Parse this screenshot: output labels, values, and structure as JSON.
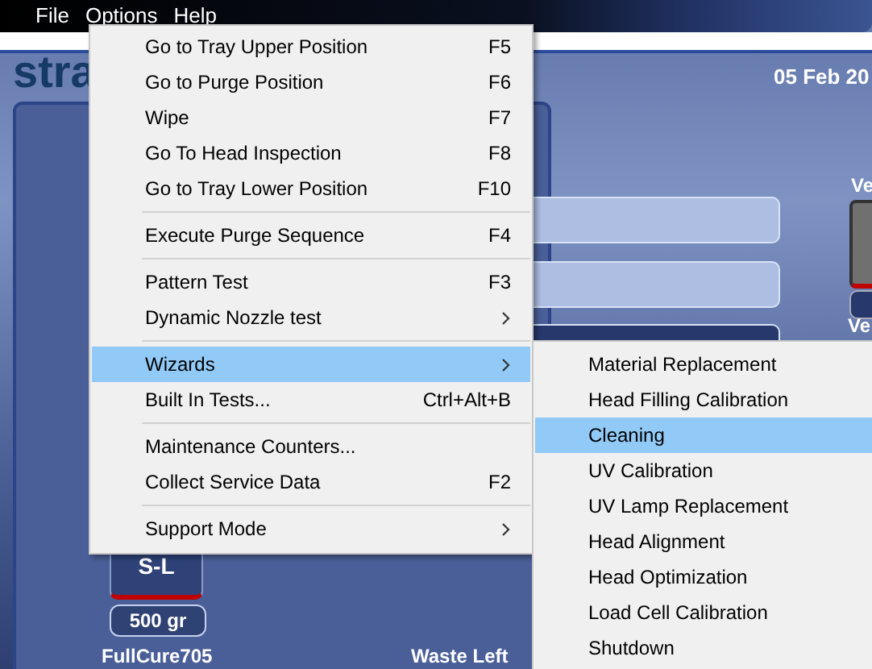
{
  "menu_bar": [
    {
      "label": "File"
    },
    {
      "label": "Options"
    },
    {
      "label": "Help"
    }
  ],
  "app": {
    "logo": "stra",
    "date": "05 Feb 20",
    "side_labels": [
      "Ve",
      "Ve"
    ],
    "cartridge": {
      "label": "S-L",
      "weight": "500 gr",
      "material": "FullCure705"
    },
    "waste_label": "Waste Left"
  },
  "options_menu": [
    {
      "kind": "item",
      "label": "Go to Tray Upper Position",
      "shortcut": "F5",
      "has_submenu": false,
      "selected": false
    },
    {
      "kind": "item",
      "label": "Go to Purge Position",
      "shortcut": "F6",
      "has_submenu": false,
      "selected": false
    },
    {
      "kind": "item",
      "label": "Wipe",
      "shortcut": "F7",
      "has_submenu": false,
      "selected": false
    },
    {
      "kind": "item",
      "label": "Go To Head Inspection",
      "shortcut": "F8",
      "has_submenu": false,
      "selected": false
    },
    {
      "kind": "item",
      "label": "Go to Tray Lower Position",
      "shortcut": "F10",
      "has_submenu": false,
      "selected": false
    },
    {
      "kind": "separator"
    },
    {
      "kind": "item",
      "label": "Execute Purge Sequence",
      "shortcut": "F4",
      "has_submenu": false,
      "selected": false
    },
    {
      "kind": "separator"
    },
    {
      "kind": "item",
      "label": "Pattern Test",
      "shortcut": "F3",
      "has_submenu": false,
      "selected": false
    },
    {
      "kind": "item",
      "label": "Dynamic Nozzle test",
      "has_submenu": true,
      "selected": false
    },
    {
      "kind": "separator"
    },
    {
      "kind": "item",
      "label": "Wizards",
      "has_submenu": true,
      "selected": true
    },
    {
      "kind": "item",
      "label": "Built In Tests...",
      "shortcut": "Ctrl+Alt+B",
      "has_submenu": false,
      "selected": false
    },
    {
      "kind": "separator"
    },
    {
      "kind": "item",
      "label": "Maintenance Counters...",
      "has_submenu": false,
      "selected": false
    },
    {
      "kind": "item",
      "label": "Collect Service Data",
      "shortcut": "F2",
      "has_submenu": false,
      "selected": false
    },
    {
      "kind": "separator"
    },
    {
      "kind": "item",
      "label": "Support Mode",
      "has_submenu": true,
      "selected": false
    }
  ],
  "wizards_submenu": [
    {
      "label": "Material Replacement",
      "selected": false
    },
    {
      "label": "Head Filling Calibration",
      "selected": false
    },
    {
      "label": "Cleaning",
      "selected": true
    },
    {
      "label": "UV Calibration",
      "selected": false
    },
    {
      "label": "UV Lamp Replacement",
      "selected": false
    },
    {
      "label": "Head Alignment",
      "selected": false
    },
    {
      "label": "Head Optimization",
      "selected": false
    },
    {
      "label": "Load Cell Calibration",
      "selected": false
    },
    {
      "label": "Shutdown",
      "selected": false
    }
  ]
}
